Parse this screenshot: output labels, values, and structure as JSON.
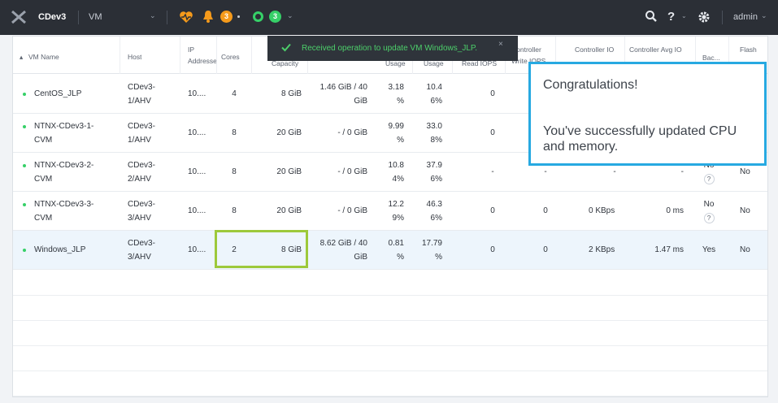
{
  "topbar": {
    "cluster": "CDev3",
    "entity": "VM",
    "alert_count": "3",
    "task_count": "3",
    "user": "admin"
  },
  "table": {
    "columns": [
      "VM Name",
      "Host",
      "IP Addresses",
      "Cores",
      "Capacity",
      "Usage",
      "Usage",
      "Read IOPS",
      "Controller Write IOPS",
      "Controller IO",
      "Controller Avg IO",
      "Bac...",
      "Flash"
    ],
    "sort_indicator": "▴",
    "rows": [
      {
        "name": "CentOS_JLP",
        "host": "CDev3-1/AHV",
        "ip": "10....",
        "cores": "4",
        "memory": "8 GiB",
        "disk": "1.46 GiB / 40 GiB",
        "cpu": "3.18 %",
        "mem_usage": "10.4 6%",
        "read_iops": "0",
        "write_iops": "",
        "io_bw": "",
        "avg_latency": "",
        "backup": "",
        "flash": ""
      },
      {
        "name": "NTNX-CDev3-1-CVM",
        "host": "CDev3-1/AHV",
        "ip": "10....",
        "cores": "8",
        "memory": "20 GiB",
        "disk": "- / 0 GiB",
        "cpu": "9.99 %",
        "mem_usage": "33.0 8%",
        "read_iops": "0",
        "write_iops": "",
        "io_bw": "",
        "avg_latency": "",
        "backup": "",
        "flash": ""
      },
      {
        "name": "NTNX-CDev3-2-CVM",
        "host": "CDev3-2/AHV",
        "ip": "10....",
        "cores": "8",
        "memory": "20 GiB",
        "disk": "- / 0 GiB",
        "cpu": "10.8 4%",
        "mem_usage": "37.9 6%",
        "read_iops": "-",
        "write_iops": "-",
        "io_bw": "-",
        "avg_latency": "-",
        "backup": "No ?",
        "flash": "No"
      },
      {
        "name": "NTNX-CDev3-3-CVM",
        "host": "CDev3-3/AHV",
        "ip": "10....",
        "cores": "8",
        "memory": "20 GiB",
        "disk": "- / 0 GiB",
        "cpu": "12.2 9%",
        "mem_usage": "46.3 6%",
        "read_iops": "0",
        "write_iops": "0",
        "io_bw": "0 KBps",
        "avg_latency": "0 ms",
        "backup": "No ?",
        "flash": "No"
      },
      {
        "name": "Windows_JLP",
        "host": "CDev3-3/AHV",
        "ip": "10....",
        "cores": "2",
        "memory": "8 GiB",
        "disk": "8.62 GiB / 40 GiB",
        "cpu": "0.81 %",
        "mem_usage": "17.79 %",
        "read_iops": "0",
        "write_iops": "0",
        "io_bw": "2 KBps",
        "avg_latency": "1.47 ms",
        "backup": "Yes",
        "flash": "No"
      }
    ]
  },
  "toast": {
    "message": "Received operation to update VM Windows_JLP.",
    "close": "×"
  },
  "callout": {
    "title": "Congratulations!",
    "body": "You've successfully updated CPU and memory."
  },
  "colors": {
    "topbar": "#2b2f36",
    "success": "#36d068",
    "alert": "#f59a1b",
    "callout_border": "#27a9e1",
    "highlight": "#9dc93b",
    "selected_row": "#edf5fc"
  }
}
